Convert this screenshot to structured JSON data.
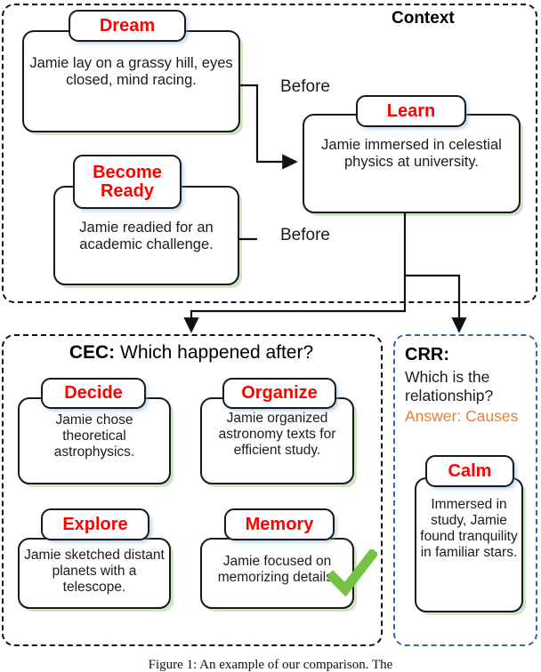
{
  "figure": {
    "caption": "Figure 1:  An example of our comparison. The"
  },
  "context_panel": {
    "title": "Context",
    "cards": [
      {
        "id": "dream",
        "label": "Dream",
        "text": "Jamie lay on a grassy hill, eyes closed, mind racing."
      },
      {
        "id": "become-ready",
        "label": "Become Ready",
        "text": "Jamie readied for an academic challenge."
      },
      {
        "id": "learn",
        "label": "Learn",
        "text": "Jamie immersed in celestial physics at university."
      }
    ],
    "edges": [
      {
        "id": "dream-to-learn",
        "label": "Before"
      },
      {
        "id": "ready-to-learn",
        "label": "Before"
      }
    ]
  },
  "cec_panel": {
    "title_bold": "CEC:",
    "title_rest": " Which happened after?",
    "options": [
      {
        "id": "decide",
        "label": "Decide",
        "text": "Jamie chose theoretical astrophysics.",
        "correct": false
      },
      {
        "id": "organize",
        "label": "Organize",
        "text": "Jamie organized astronomy texts for efficient study.",
        "correct": false
      },
      {
        "id": "explore",
        "label": "Explore",
        "text": "Jamie sketched distant planets with a telescope.",
        "correct": false
      },
      {
        "id": "memory",
        "label": "Memory",
        "text": "Jamie focused on memorizing details.",
        "correct": true
      }
    ],
    "correct_mark": "check-mark"
  },
  "crr_panel": {
    "title": "CRR:",
    "question": "Which is the relationship?",
    "answer": "Answer: Causes",
    "card": {
      "id": "calm",
      "label": "Calm",
      "text": "Immersed in study, Jamie found tranquility in familiar stars."
    }
  },
  "colors": {
    "label_red": "#ff0000",
    "answer_orange": "#ed7d31",
    "panel_black": "#111111",
    "panel_blue": "#3b63a8",
    "check_green": "#76c043",
    "card_shadow_green": "#c8e1be"
  }
}
